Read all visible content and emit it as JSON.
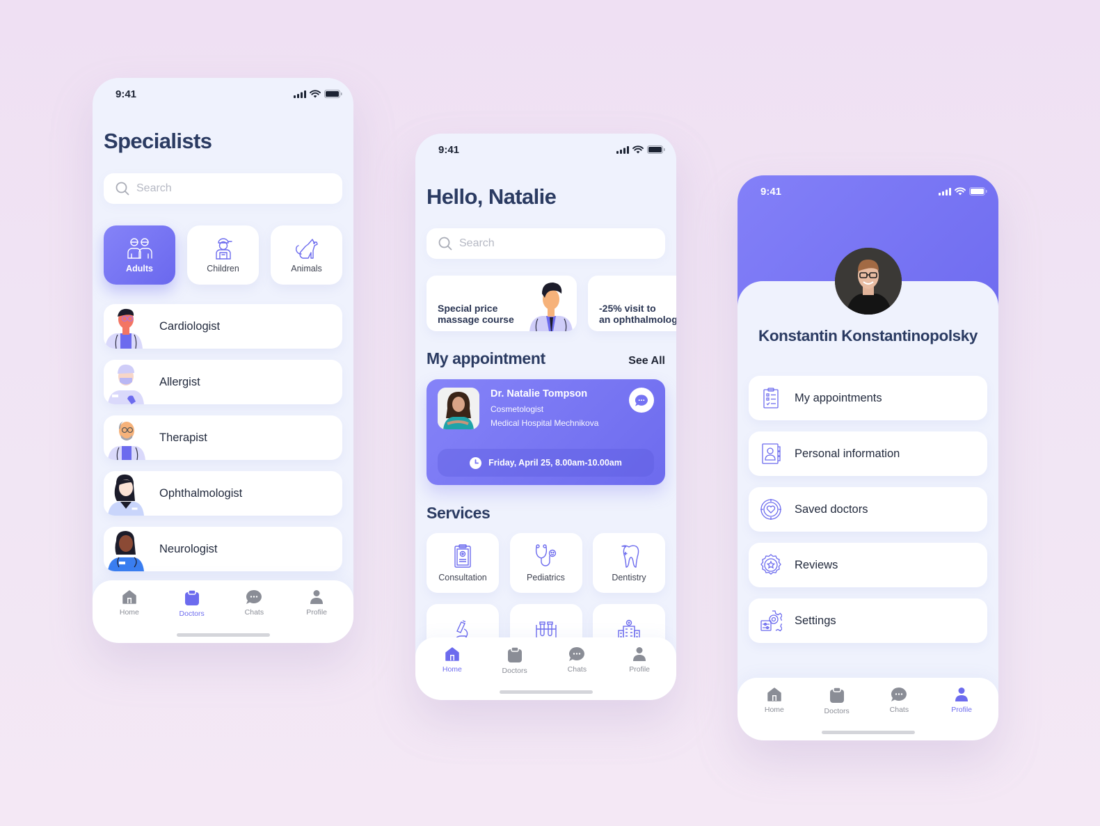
{
  "colors": {
    "accent": "#6c6bee",
    "title": "#2b3b62",
    "screen_bg": "#eff2fd",
    "page_bg": "#efe0f3",
    "inactive": "#8a8d96"
  },
  "status_bar": {
    "time": "9:41"
  },
  "specialists_screen": {
    "title": "Specialists",
    "search": {
      "placeholder": "Search",
      "value": ""
    },
    "categories": [
      {
        "label": "Adults",
        "icon": "adults-icon",
        "active": true
      },
      {
        "label": "Children",
        "icon": "child-icon",
        "active": false
      },
      {
        "label": "Animals",
        "icon": "dog-icon",
        "active": false
      }
    ],
    "specialists": [
      {
        "label": "Cardiologist"
      },
      {
        "label": "Allergist"
      },
      {
        "label": "Therapist"
      },
      {
        "label": "Ophthalmologist"
      },
      {
        "label": "Neurologist"
      }
    ],
    "active_tab": "Doctors"
  },
  "home_screen": {
    "greeting": "Hello, Natalie",
    "search": {
      "placeholder": "Search",
      "value": ""
    },
    "promos": [
      {
        "text": "Special price\nmassage course"
      },
      {
        "text": "-25% visit to\nan ophthalmolog"
      }
    ],
    "appointment_section": {
      "title": "My appointment",
      "see_all": "See All"
    },
    "appointment": {
      "doctor": "Dr. Natalie Tompson",
      "specialty": "Cosmetologist",
      "hospital": "Medical Hospital Mechnikova",
      "time": "Friday, April 25, 8.00am-10.00am"
    },
    "services_title": "Services",
    "services": [
      {
        "label": "Consultation",
        "icon": "clipboard-medical-icon"
      },
      {
        "label": "Pediatrics",
        "icon": "stethoscope-icon"
      },
      {
        "label": "Dentistry",
        "icon": "tooth-icon"
      },
      {
        "label": "",
        "icon": "microscope-icon"
      },
      {
        "label": "",
        "icon": "test-tubes-icon"
      },
      {
        "label": "",
        "icon": "hospital-icon"
      }
    ],
    "active_tab": "Home"
  },
  "profile_screen": {
    "name": "Konstantin Konstantinopolsky",
    "menu": [
      {
        "label": "My appointments",
        "icon": "checklist-icon"
      },
      {
        "label": "Personal information",
        "icon": "contact-book-icon"
      },
      {
        "label": "Saved doctors",
        "icon": "heart-target-icon"
      },
      {
        "label": "Reviews",
        "icon": "star-badge-icon"
      },
      {
        "label": "Settings",
        "icon": "gear-sliders-icon"
      }
    ],
    "active_tab": "Profile"
  },
  "tabbar": {
    "tabs": [
      {
        "label": "Home",
        "icon": "home-icon"
      },
      {
        "label": "Doctors",
        "icon": "clipboard-icon"
      },
      {
        "label": "Chats",
        "icon": "chat-bubble-icon"
      },
      {
        "label": "Profile",
        "icon": "person-icon"
      }
    ]
  }
}
